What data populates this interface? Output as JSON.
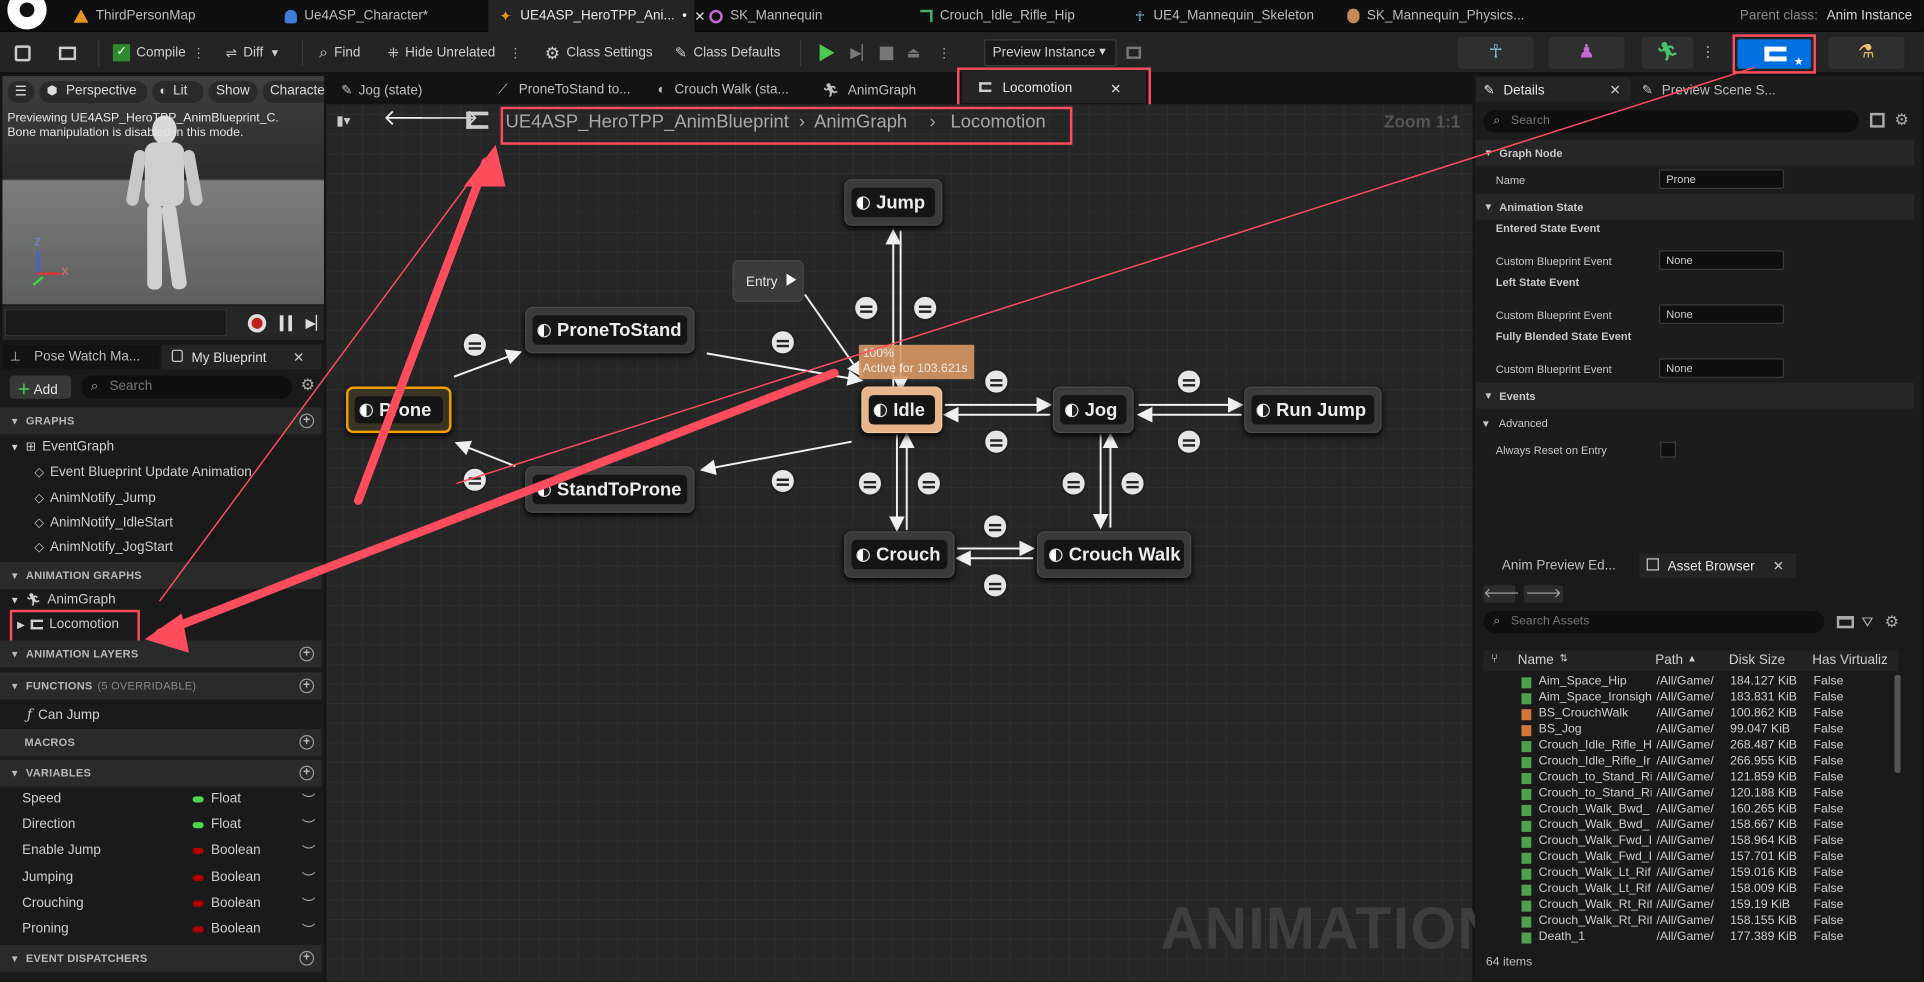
{
  "doc_tabs": [
    {
      "label": "ThirdPersonMap"
    },
    {
      "label": "Ue4ASP_Character*"
    },
    {
      "label": "UE4ASP_HeroTPP_Ani...",
      "modified": "•"
    },
    {
      "label": "SK_Mannequin"
    },
    {
      "label": "Crouch_Idle_Rifle_Hip"
    },
    {
      "label": "UE4_Mannequin_Skeleton"
    },
    {
      "label": "SK_Mannequin_Physics..."
    }
  ],
  "parent_class": {
    "label": "Parent class:",
    "value": "Anim Instance"
  },
  "toolbar": {
    "compile": "Compile",
    "diff": "Diff",
    "find": "Find",
    "hide_unrelated": "Hide Unrelated",
    "class_settings": "Class Settings",
    "class_defaults": "Class Defaults",
    "preview_instance": "Preview Instance"
  },
  "viewport": {
    "perspective": "Perspective",
    "lit": "Lit",
    "show": "Show",
    "character": "Characte",
    "previewing": "Previewing UE4ASP_HeroTPP_AnimBlueprint_C.",
    "bone_note": "Bone manipulation is disabled in this mode.",
    "axis_z": "Z",
    "axis_x": "X"
  },
  "left_tabs": {
    "pose_watch": "Pose Watch Ma...",
    "my_blueprint": "My Blueprint"
  },
  "my_blueprint": {
    "add": "Add",
    "search_placeholder": "Search",
    "graphs": "GRAPHS",
    "event_graph": "EventGraph",
    "graph_items": [
      "Event Blueprint Update Animation",
      "AnimNotify_Jump",
      "AnimNotify_IdleStart",
      "AnimNotify_JogStart"
    ],
    "animation_graphs": "ANIMATION GRAPHS",
    "anim_graph": "AnimGraph",
    "locomotion": "Locomotion",
    "animation_layers": "ANIMATION LAYERS",
    "functions": "FUNCTIONS",
    "functions_count": "(5 OVERRIDABLE)",
    "can_jump": "Can Jump",
    "macros": "MACROS",
    "variables": "VARIABLES",
    "vars": [
      {
        "name": "Speed",
        "type": "Float",
        "color": "#4ed84e"
      },
      {
        "name": "Direction",
        "type": "Float",
        "color": "#4ed84e"
      },
      {
        "name": "Enable Jump",
        "type": "Boolean",
        "color": "#b00000"
      },
      {
        "name": "Jumping",
        "type": "Boolean",
        "color": "#b00000"
      },
      {
        "name": "Crouching",
        "type": "Boolean",
        "color": "#b00000"
      },
      {
        "name": "Proning",
        "type": "Boolean",
        "color": "#b00000"
      }
    ],
    "event_dispatchers": "EVENT DISPATCHERS"
  },
  "graph_tabs": [
    "Jog (state)",
    "ProneToStand to...",
    "Crouch Walk (sta...",
    "AnimGraph",
    "Locomotion"
  ],
  "breadcrumb": [
    "UE4ASP_HeroTPP_AnimBlueprint",
    "AnimGraph",
    "Locomotion"
  ],
  "zoom": "Zoom 1:1",
  "nodes": {
    "entry": "Entry",
    "jump": "Jump",
    "prone_to_stand": "ProneToStand",
    "prone": "Prone",
    "stand_to_prone": "StandToProne",
    "idle": "Idle",
    "jog": "Jog",
    "run_jump": "Run Jump",
    "crouch": "Crouch",
    "crouch_walk": "Crouch Walk"
  },
  "idle_tooltip": {
    "percent": "100%",
    "active": "Active for 103.621s"
  },
  "watermark": "ANIMATION",
  "details": {
    "tab": "Details",
    "preview_tab": "Preview Scene S...",
    "search_placeholder": "Search",
    "graph_node": "Graph Node",
    "name_label": "Name",
    "name_value": "Prone",
    "animation_state": "Animation State",
    "entered": "Entered State Event",
    "left": "Left State Event",
    "fully": "Fully Blended State Event",
    "custom_event": "Custom Blueprint Event",
    "none": "None",
    "events": "Events",
    "advanced": "Advanced",
    "always_reset": "Always Reset on Entry"
  },
  "bottom_tabs": {
    "anim_preview": "Anim Preview Ed...",
    "asset_browser": "Asset Browser"
  },
  "asset_browser": {
    "search_placeholder": "Search Assets",
    "columns": [
      "Name",
      "Path",
      "Disk Size",
      "Has Virtualiz"
    ],
    "rows": [
      {
        "name": "Aim_Space_Hip",
        "path": "/All/Game/",
        "size": "184.127 KiB",
        "virt": "False",
        "color": "#4ea04e"
      },
      {
        "name": "Aim_Space_Ironsigh",
        "path": "/All/Game/",
        "size": "183.831 KiB",
        "virt": "False",
        "color": "#4ea04e"
      },
      {
        "name": "BS_CrouchWalk",
        "path": "/All/Game/",
        "size": "100.862 KiB",
        "virt": "False",
        "color": "#d2773a"
      },
      {
        "name": "BS_Jog",
        "path": "/All/Game/",
        "size": "99.047 KiB",
        "virt": "False",
        "color": "#d2773a"
      },
      {
        "name": "Crouch_Idle_Rifle_H",
        "path": "/All/Game/",
        "size": "268.487 KiB",
        "virt": "False",
        "color": "#4ea04e"
      },
      {
        "name": "Crouch_Idle_Rifle_Ir",
        "path": "/All/Game/",
        "size": "266.955 KiB",
        "virt": "False",
        "color": "#4ea04e"
      },
      {
        "name": "Crouch_to_Stand_Ri",
        "path": "/All/Game/",
        "size": "121.859 KiB",
        "virt": "False",
        "color": "#4ea04e"
      },
      {
        "name": "Crouch_to_Stand_Ri",
        "path": "/All/Game/",
        "size": "120.188 KiB",
        "virt": "False",
        "color": "#4ea04e"
      },
      {
        "name": "Crouch_Walk_Bwd_",
        "path": "/All/Game/",
        "size": "160.265 KiB",
        "virt": "False",
        "color": "#4ea04e"
      },
      {
        "name": "Crouch_Walk_Bwd_",
        "path": "/All/Game/",
        "size": "158.667 KiB",
        "virt": "False",
        "color": "#4ea04e"
      },
      {
        "name": "Crouch_Walk_Fwd_I",
        "path": "/All/Game/",
        "size": "158.964 KiB",
        "virt": "False",
        "color": "#4ea04e"
      },
      {
        "name": "Crouch_Walk_Fwd_I",
        "path": "/All/Game/",
        "size": "157.701 KiB",
        "virt": "False",
        "color": "#4ea04e"
      },
      {
        "name": "Crouch_Walk_Lt_Rif",
        "path": "/All/Game/",
        "size": "159.016 KiB",
        "virt": "False",
        "color": "#4ea04e"
      },
      {
        "name": "Crouch_Walk_Lt_Rif",
        "path": "/All/Game/",
        "size": "158.009 KiB",
        "virt": "False",
        "color": "#4ea04e"
      },
      {
        "name": "Crouch_Walk_Rt_Rif",
        "path": "/All/Game/",
        "size": "159.19 KiB",
        "virt": "False",
        "color": "#4ea04e"
      },
      {
        "name": "Crouch_Walk_Rt_Rif",
        "path": "/All/Game/",
        "size": "158.155 KiB",
        "virt": "False",
        "color": "#4ea04e"
      },
      {
        "name": "Death_1",
        "path": "/All/Game/",
        "size": "177.389 KiB",
        "virt": "False",
        "color": "#4ea04e"
      }
    ],
    "count": "64 items"
  },
  "colors": {
    "accent": "#0070e0",
    "highlight": "#ff4d5e",
    "selected_node": "#f0a000",
    "idle_node": "#e8b48c"
  }
}
